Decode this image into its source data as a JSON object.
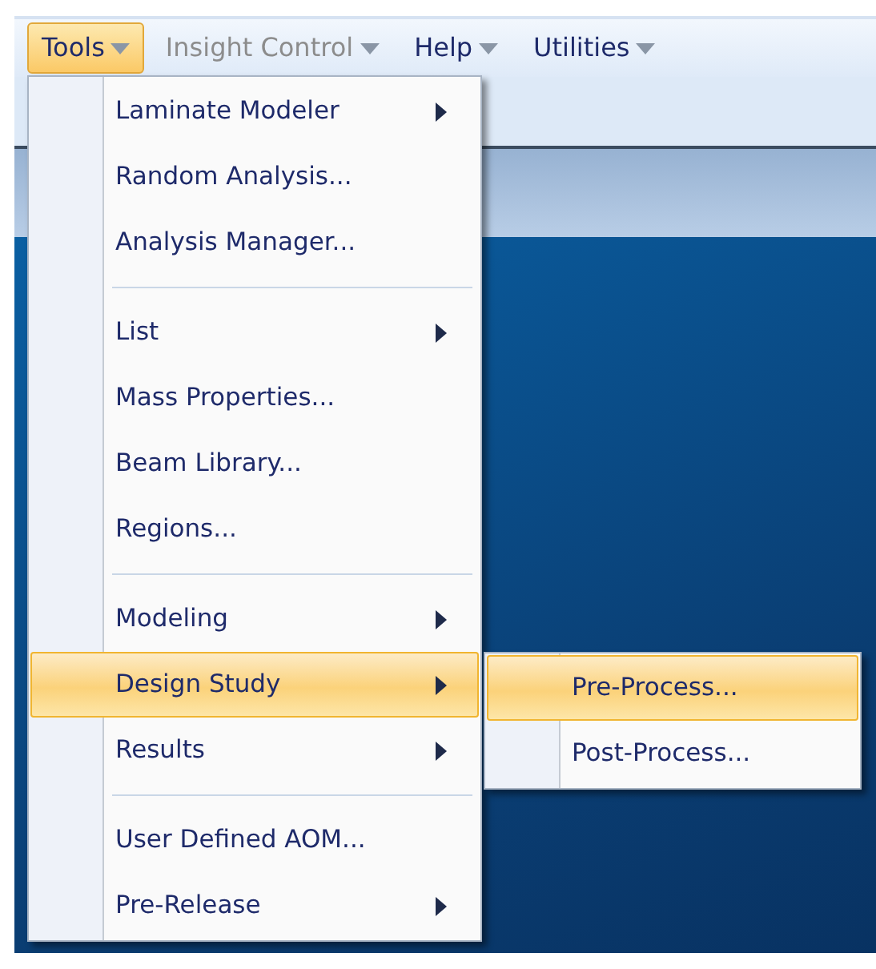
{
  "menubar": [
    {
      "label": "Tools",
      "selected": true,
      "disabled": false
    },
    {
      "label": "Insight Control",
      "selected": false,
      "disabled": true
    },
    {
      "label": "Help",
      "selected": false,
      "disabled": false
    },
    {
      "label": "Utilities",
      "selected": false,
      "disabled": false
    }
  ],
  "menu": {
    "items": [
      {
        "kind": "item",
        "label": "Laminate Modeler",
        "submenu": true,
        "selected": false
      },
      {
        "kind": "item",
        "label": "Random Analysis...",
        "submenu": false,
        "selected": false
      },
      {
        "kind": "item",
        "label": "Analysis Manager...",
        "submenu": false,
        "selected": false
      },
      {
        "kind": "separator"
      },
      {
        "kind": "item",
        "label": "List",
        "submenu": true,
        "selected": false
      },
      {
        "kind": "item",
        "label": "Mass Properties...",
        "submenu": false,
        "selected": false
      },
      {
        "kind": "item",
        "label": "Beam Library...",
        "submenu": false,
        "selected": false
      },
      {
        "kind": "item",
        "label": "Regions...",
        "submenu": false,
        "selected": false
      },
      {
        "kind": "separator"
      },
      {
        "kind": "item",
        "label": "Modeling",
        "submenu": true,
        "selected": false
      },
      {
        "kind": "item",
        "label": "Design Study",
        "submenu": true,
        "selected": true
      },
      {
        "kind": "item",
        "label": "Results",
        "submenu": true,
        "selected": false
      },
      {
        "kind": "separator"
      },
      {
        "kind": "item",
        "label": "User Defined AOM...",
        "submenu": false,
        "selected": false
      },
      {
        "kind": "item",
        "label": "Pre-Release",
        "submenu": true,
        "selected": false
      }
    ]
  },
  "submenu": {
    "items": [
      {
        "kind": "item",
        "label": "Pre-Process...",
        "submenu": false,
        "selected": true
      },
      {
        "kind": "item",
        "label": "Post-Process...",
        "submenu": false,
        "selected": false
      }
    ]
  }
}
